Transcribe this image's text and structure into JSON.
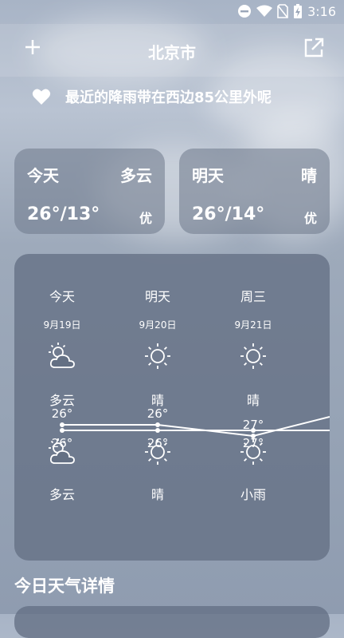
{
  "status": {
    "time": "3:16"
  },
  "header": {
    "city": "北京市"
  },
  "notice": {
    "text": "最近的降雨带在西边85公里外呢"
  },
  "cards": [
    {
      "day": "今天",
      "condition": "多云",
      "temp": "26°/13°",
      "aqi": "优"
    },
    {
      "day": "明天",
      "condition": "晴",
      "temp": "26°/14°",
      "aqi": "优"
    }
  ],
  "forecast": [
    {
      "name": "今天",
      "date": "9月19日",
      "day_condition": "多云",
      "high": "26°",
      "low": "26°",
      "night_condition": "多云",
      "day_icon": "partly-cloudy-icon",
      "night_icon": "partly-cloudy-icon"
    },
    {
      "name": "明天",
      "date": "9月20日",
      "day_condition": "晴",
      "high": "26°",
      "low": "26°",
      "night_condition": "晴",
      "day_icon": "sun-icon",
      "night_icon": "sun-icon"
    },
    {
      "name": "周三",
      "date": "9月21日",
      "day_condition": "晴",
      "high": "27°",
      "low": "27°",
      "night_condition": "小雨",
      "day_icon": "sun-icon",
      "night_icon": "sun-icon"
    }
  ],
  "details": {
    "title": "今日天气详情"
  }
}
